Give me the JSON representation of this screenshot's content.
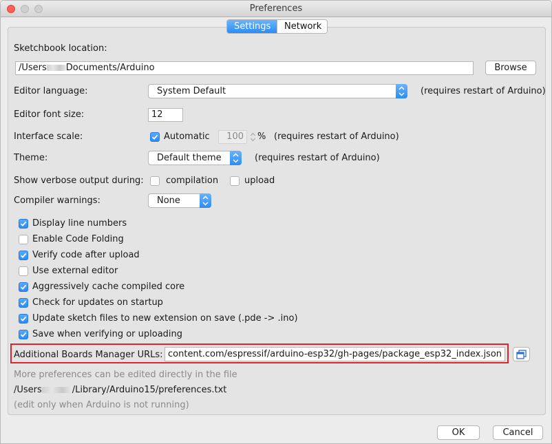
{
  "window": {
    "title": "Preferences"
  },
  "tabs": [
    {
      "label": "Settings",
      "active": true
    },
    {
      "label": "Network",
      "active": false
    }
  ],
  "settings": {
    "sketchbook": {
      "label": "Sketchbook location:",
      "path_prefix": "/Users",
      "path_suffix": "Documents/Arduino",
      "browse_label": "Browse"
    },
    "editor_language": {
      "label": "Editor language:",
      "value": "System Default",
      "note": "(requires restart of Arduino)"
    },
    "editor_font_size": {
      "label": "Editor font size:",
      "value": "12"
    },
    "interface_scale": {
      "label": "Interface scale:",
      "automatic_label": "Automatic",
      "automatic_checked": true,
      "value": "100",
      "unit": "%",
      "note": "(requires restart of Arduino)"
    },
    "theme": {
      "label": "Theme:",
      "value": "Default theme",
      "note": "(requires restart of Arduino)"
    },
    "verbose": {
      "label": "Show verbose output during:",
      "compilation_label": "compilation",
      "compilation_checked": false,
      "upload_label": "upload",
      "upload_checked": false
    },
    "compiler_warnings": {
      "label": "Compiler warnings:",
      "value": "None"
    },
    "options": [
      {
        "label": "Display line numbers",
        "checked": true
      },
      {
        "label": "Enable Code Folding",
        "checked": false
      },
      {
        "label": "Verify code after upload",
        "checked": true
      },
      {
        "label": "Use external editor",
        "checked": false
      },
      {
        "label": "Aggressively cache compiled core",
        "checked": true
      },
      {
        "label": "Check for updates on startup",
        "checked": true
      },
      {
        "label": "Update sketch files to new extension on save (.pde -> .ino)",
        "checked": true
      },
      {
        "label": "Save when verifying or uploading",
        "checked": true
      }
    ],
    "boards_manager": {
      "label": "Additional Boards Manager URLs:",
      "value": "content.com/espressif/arduino-esp32/gh-pages/package_esp32_index.json"
    },
    "footer": {
      "more_prefs": "More preferences can be edited directly in the file",
      "file_prefix": "/Users",
      "file_suffix": "/Library/Arduino15/preferences.txt",
      "edit_note": "(edit only when Arduino is not running)"
    }
  },
  "actions": {
    "ok_label": "OK",
    "cancel_label": "Cancel"
  },
  "colors": {
    "accent": "#2a8cf7",
    "highlight_border": "#e2242a",
    "close": "#fc5f57"
  }
}
